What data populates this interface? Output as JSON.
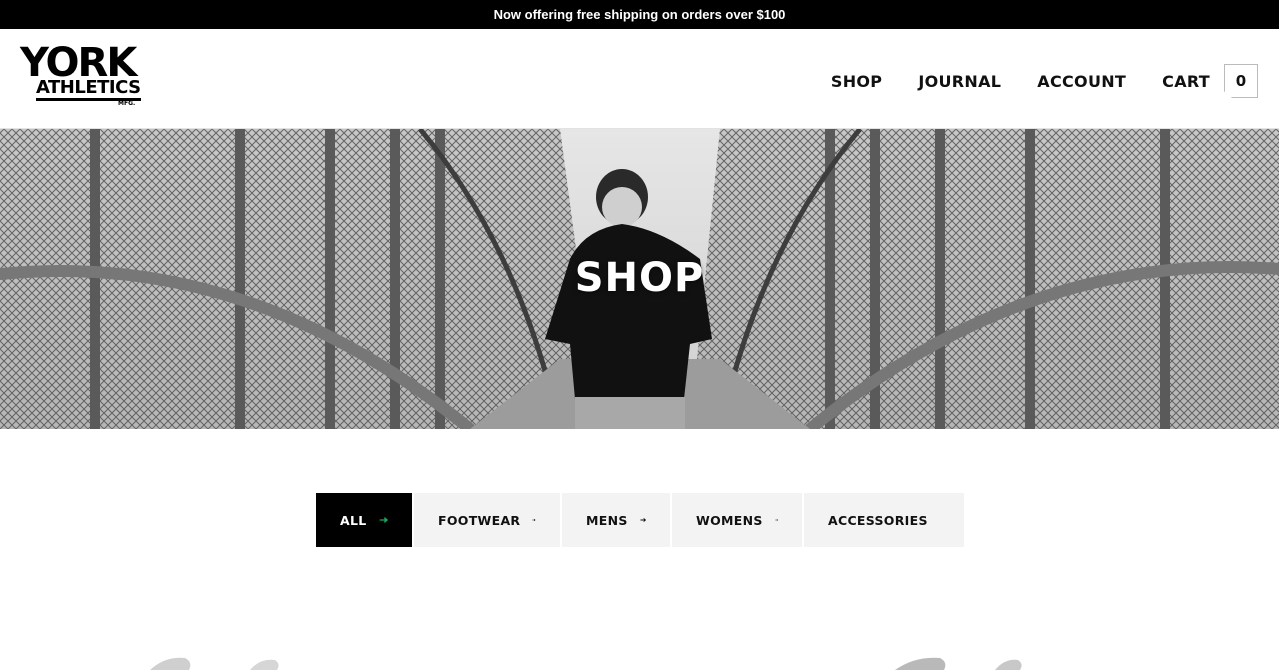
{
  "promo": {
    "text": "Now offering free shipping on orders over $100"
  },
  "header": {
    "logo": {
      "line1": "YORK",
      "line2": "ATHLETICS",
      "line3": "MFG."
    },
    "nav": [
      {
        "label": "SHOP"
      },
      {
        "label": "JOURNAL"
      },
      {
        "label": "ACCOUNT"
      },
      {
        "label": "CART"
      }
    ],
    "cart_count": "0"
  },
  "hero": {
    "title": "SHOP",
    "image": "runner-on-fenced-bridge-photo"
  },
  "filters": [
    {
      "label": "ALL",
      "active": true
    },
    {
      "label": "FOOTWEAR",
      "active": false
    },
    {
      "label": "MENS",
      "active": false
    },
    {
      "label": "WOMENS",
      "active": false
    },
    {
      "label": "ACCESSORIES",
      "active": false
    }
  ],
  "colors": {
    "accent": "#1aa35a",
    "promo_bg": "#000000",
    "tab_bg": "#f3f3f3"
  },
  "icons": {
    "filter_arrow": "arrow-right-icon"
  }
}
